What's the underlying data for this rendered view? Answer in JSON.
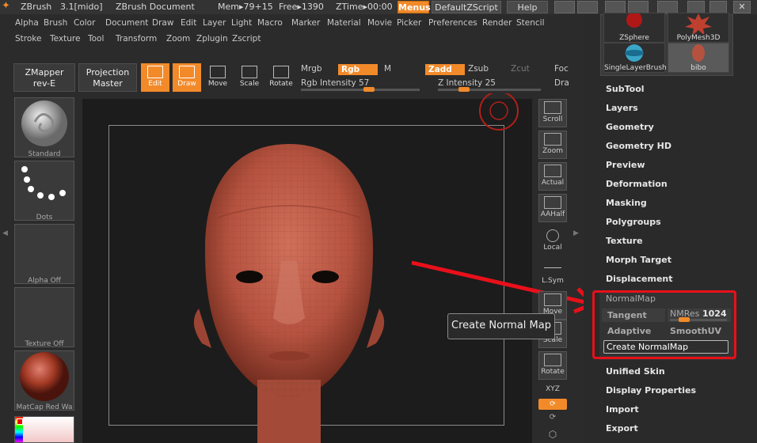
{
  "titlebar": {
    "app": "ZBrush",
    "version": "3.1[mido]",
    "document": "ZBrush Document",
    "mem": "Mem▸79+15",
    "free": "Free▸1390",
    "ztime": "ZTime▸00:00",
    "menus_label": "Menus",
    "script_label": "DefaultZScript",
    "help_label": "Help"
  },
  "menu_row1": [
    "Alpha",
    "Brush",
    "Color",
    "Document",
    "Draw",
    "Edit",
    "Layer",
    "Light",
    "Macro",
    "Marker",
    "Material",
    "Movie",
    "Picker",
    "Preferences",
    "Render",
    "Stencil"
  ],
  "menu_row2": [
    "Stroke",
    "Texture",
    "Tool",
    "Transform",
    "Zoom",
    "Zplugin",
    "Zscript"
  ],
  "toolbar": {
    "zmapper": [
      "ZMapper",
      "rev-E"
    ],
    "projection": [
      "Projection",
      "Master"
    ],
    "edit": "Edit",
    "draw": "Draw",
    "move": "Move",
    "scale": "Scale",
    "rotate": "Rotate",
    "mrgb": "Mrgb",
    "rgb": "Rgb",
    "m": "M",
    "zadd": "Zadd",
    "zsub": "Zsub",
    "zcut": "Zcut",
    "rgb_intensity": "Rgb Intensity 57",
    "z_intensity": "Z Intensity 25",
    "foc": "Foc",
    "dra": "Dra"
  },
  "shelf": {
    "standard": "Standard",
    "dots": "Dots",
    "alpha": "Alpha Off",
    "texture": "Texture Off",
    "matcap": "MatCap Red Wa"
  },
  "vtools": [
    "Scroll",
    "Zoom",
    "Actual",
    "AAHalf",
    "Local",
    "L.Sym",
    "Move",
    "Scale",
    "Rotate",
    "XYZ"
  ],
  "thumbs": {
    "zsphere": "ZSphere",
    "polymesh": "PolyMesh3D",
    "singlelayer": "SingleLayerBrush",
    "bibo": "bibo"
  },
  "panel_items_top": [
    "SubTool",
    "Layers",
    "Geometry",
    "Geometry HD",
    "Preview",
    "Deformation",
    "Masking",
    "Polygroups",
    "Texture",
    "Morph Target",
    "Displacement"
  ],
  "normalmap": {
    "header": "NormalMap",
    "tangent": "Tangent",
    "nmres_label": "NMRes",
    "nmres_value": "1024",
    "nmres_fraction": 0.25,
    "adaptive": "Adaptive",
    "smoothuv": "SmoothUV",
    "create": "Create NormalMap"
  },
  "panel_items_bottom": [
    "Unified Skin",
    "Display Properties",
    "Import",
    "Export"
  ],
  "tooltip": "Create Normal Map",
  "sliders": {
    "rgb_intensity": 57,
    "z_intensity": 25
  },
  "colors": {
    "accent": "#f28a2a",
    "annotation": "#e8101a",
    "head": "#b5523f"
  }
}
